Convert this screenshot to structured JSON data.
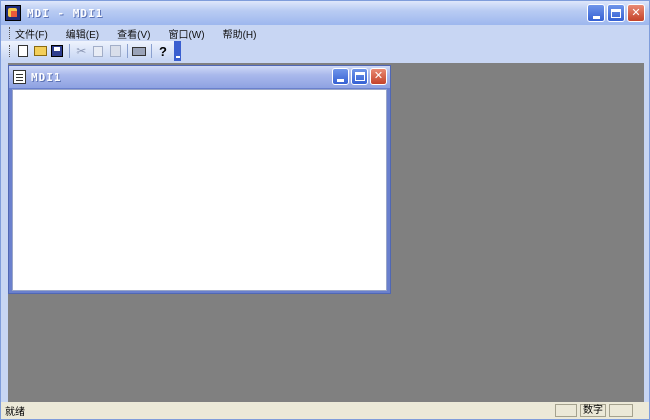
{
  "window": {
    "title": "MDI - MDI1"
  },
  "menubar": {
    "items": [
      {
        "label": "文件(F)"
      },
      {
        "label": "编辑(E)"
      },
      {
        "label": "查看(V)"
      },
      {
        "label": "窗口(W)"
      },
      {
        "label": "帮助(H)"
      }
    ]
  },
  "toolbar": {
    "icons": [
      "new-icon",
      "open-icon",
      "save-icon",
      "cut-icon",
      "copy-icon",
      "paste-icon",
      "print-icon",
      "help-icon"
    ]
  },
  "child": {
    "title": "MDI1"
  },
  "statusbar": {
    "text": "就绪",
    "panes": [
      "",
      "数字",
      ""
    ]
  },
  "colors": {
    "frame_bg": "#c8d6f3",
    "client_bg": "#808080",
    "close_red": "#c4432a",
    "caption_blue": "#3560d3"
  }
}
